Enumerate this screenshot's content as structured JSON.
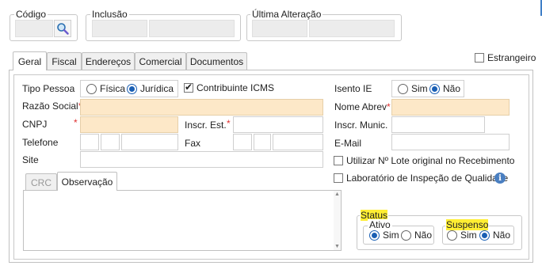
{
  "header": {
    "codigo_label": "Código",
    "inclusao_label": "Inclusão",
    "ultima_alteracao_label": "Última Alteração"
  },
  "tabs": [
    {
      "label": "Geral"
    },
    {
      "label": "Fiscal"
    },
    {
      "label": "Endereços"
    },
    {
      "label": "Comercial"
    },
    {
      "label": "Documentos"
    }
  ],
  "estrangeiro_label": "Estrangeiro",
  "form": {
    "tipo_pessoa_label": "Tipo Pessoa",
    "fisica_label": "Física",
    "juridica_label": "Jurídica",
    "contribuinte_label": "Contribuinte ICMS",
    "razao_social_label": "Razão Social",
    "cnpj_label": "CNPJ",
    "inscr_est_label": "Inscr. Est.",
    "telefone_label": "Telefone",
    "fax_label": "Fax",
    "site_label": "Site",
    "isento_ie_label": "Isento IE",
    "sim_label": "Sim",
    "nao_label": "Não",
    "nome_abrev_label": "Nome Abrev",
    "inscr_munic_label": "Inscr. Munic.",
    "email_label": "E-Mail",
    "utilizar_lote_label": "Utilizar Nº Lote original no Recebimento",
    "laboratorio_label": "Laboratório de Inspeção de Qualidade",
    "required_marker": "*"
  },
  "subtabs": [
    {
      "label": "CRC"
    },
    {
      "label": "Observação"
    }
  ],
  "status": {
    "title": "Status",
    "ativo_label": "Ativo",
    "suspenso_label": "Suspenso",
    "sim_label": "Sim",
    "nao_label": "Não"
  },
  "colors": {
    "required_bg": "#fde8c8",
    "radio_accent": "#1a5fb4",
    "highlight": "#ffee33",
    "info_icon": "#4a7fc1"
  }
}
